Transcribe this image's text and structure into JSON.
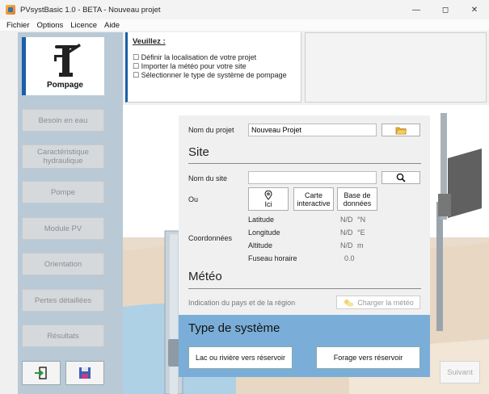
{
  "window": {
    "title": "PVsystBasic 1.0 - BETA - Nouveau projet"
  },
  "menu": [
    "Fichier",
    "Options",
    "Licence",
    "Aide"
  ],
  "sidebar": {
    "pump_label": "Pompage",
    "items": [
      "Besoin en eau",
      "Caractéristique hydraulique",
      "Pompe",
      "Module PV",
      "Orientation",
      "Pertes détaillées",
      "Résultats"
    ]
  },
  "instructions": {
    "title": "Veuillez :",
    "items": [
      "Définir la localisation de votre projet",
      "Importer la météo pour votre site",
      "Sélectionner le type de système de pompage"
    ]
  },
  "project": {
    "label": "Nom du projet",
    "value": "Nouveau Projet"
  },
  "site": {
    "title": "Site",
    "name_label": "Nom du site",
    "name_value": "",
    "or_label": "Ou",
    "btn_here": "Ici",
    "btn_map_line1": "Carte",
    "btn_map_line2": "interactive",
    "btn_db_line1": "Base de",
    "btn_db_line2": "données",
    "coords_label": "Coordonnées",
    "fields": [
      {
        "label": "Latitude",
        "value": "N/D",
        "unit": "°N"
      },
      {
        "label": "Longitude",
        "value": "N/D",
        "unit": "°E"
      },
      {
        "label": "Altitude",
        "value": "N/D",
        "unit": "m"
      },
      {
        "label": "Fuseau horaire",
        "value": "0.0",
        "unit": ""
      }
    ]
  },
  "meteo": {
    "title": "Météo",
    "hint": "Indication du pays et de la région",
    "btn": "Charger la météo"
  },
  "system": {
    "title": "Type de système",
    "btn_lake": "Lac ou rivière vers réservoir",
    "btn_well": "Forage vers réservoir"
  },
  "footer": {
    "next": "Suivant"
  },
  "colors": {
    "accent": "#1a5fa8",
    "sidebar": "#b9c9d6",
    "system_bg": "#7aaed8"
  }
}
